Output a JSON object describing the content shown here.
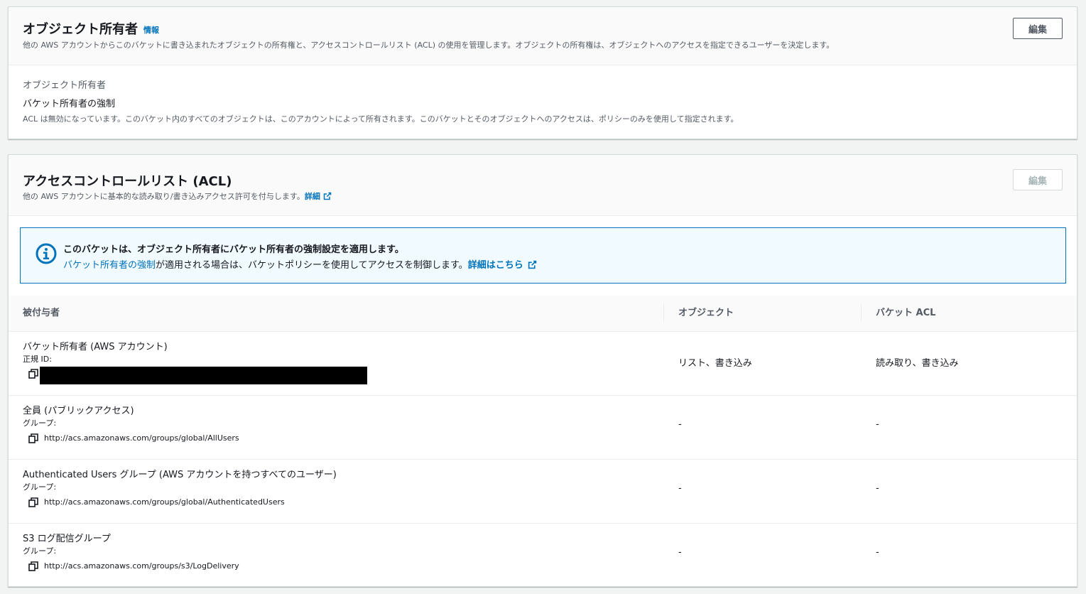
{
  "owner_panel": {
    "title": "オブジェクト所有者",
    "info_link": "情報",
    "description": "他の AWS アカウントからこのバケットに書き込まれたオブジェクトの所有権と、アクセスコントロールリスト (ACL) の使用を管理します。オブジェクトの所有権は、オブジェクトへのアクセスを指定できるユーザーを決定します。",
    "edit_label": "編集",
    "field_label": "オブジェクト所有者",
    "field_value": "バケット所有者の強制",
    "field_note": "ACL は無効になっています。このバケット内のすべてのオブジェクトは、このアカウントによって所有されます。このバケットとそのオブジェクトへのアクセスは、ポリシーのみを使用して指定されます。"
  },
  "acl_panel": {
    "title": "アクセスコントロールリスト (ACL)",
    "description": "他の AWS アカウントに基本的な読み取り/書き込みアクセス許可を付与します。",
    "details_link": "詳細",
    "edit_label": "編集",
    "edit_disabled": true,
    "alert": {
      "title": "このバケットは、オブジェクト所有者にバケット所有者の強制設定を適用します。",
      "link_text": "バケット所有者の強制",
      "body": "が適用される場合は、バケットポリシーを使用してアクセスを制御します。",
      "more_link": "詳細はこちら"
    },
    "table": {
      "headers": [
        "被付与者",
        "オブジェクト",
        "バケット ACL"
      ],
      "rows": [
        {
          "name": "バケット所有者 (AWS アカウント)",
          "type": "正規 ID:",
          "id": "",
          "redacted": true,
          "objects": "リスト、書き込み",
          "bucket_acl": "読み取り、書き込み"
        },
        {
          "name": "全員 (パブリックアクセス)",
          "type": "グループ:",
          "id": "http://acs.amazonaws.com/groups/global/AllUsers",
          "redacted": false,
          "objects": "-",
          "bucket_acl": "-"
        },
        {
          "name": "Authenticated Users グループ (AWS アカウントを持つすべてのユーザー)",
          "type": "グループ:",
          "id": "http://acs.amazonaws.com/groups/global/AuthenticatedUsers",
          "redacted": false,
          "objects": "-",
          "bucket_acl": "-"
        },
        {
          "name": "S3 ログ配信グループ",
          "type": "グループ:",
          "id": "http://acs.amazonaws.com/groups/s3/LogDelivery",
          "redacted": false,
          "objects": "-",
          "bucket_acl": "-"
        }
      ]
    }
  },
  "colors": {
    "link": "#0073bb",
    "alert_bg": "#f1faff",
    "alert_border": "#0073bb",
    "text": "#16191f",
    "secondary_text": "#545b64"
  }
}
